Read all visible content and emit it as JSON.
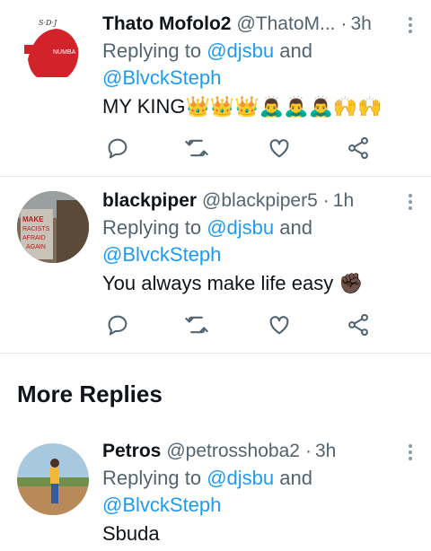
{
  "tweets": [
    {
      "name": "Thato Mofolo2",
      "handle": "@ThatoM...",
      "time": "3h",
      "replying_prefix": "Replying to ",
      "mention1": "@djsbu",
      "and": " and",
      "mention2": "@BlvckSteph",
      "text": "MY KING👑👑👑🙇‍♂️🙇‍♂️🙇‍♂️🙌🙌",
      "avatar_label": "NUMBA"
    },
    {
      "name": "blackpiper",
      "handle": "@blackpiper5",
      "time": "1h",
      "replying_prefix": "Replying to ",
      "mention1": "@djsbu",
      "and": " and",
      "mention2": "@BlvckSteph",
      "text": "You always make life easy ✊🏿",
      "avatar_label": "MAKE RACISTS AFRAID"
    },
    {
      "name": "Petros",
      "handle": "@petrosshoba2",
      "time": "3h",
      "replying_prefix": "Replying to ",
      "mention1": "@djsbu",
      "and": " and",
      "mention2": "@BlvckSteph",
      "text": "Sbuda"
    }
  ],
  "section": {
    "title": "More Replies"
  },
  "actions": [
    "reply-icon",
    "retweet-icon",
    "like-icon",
    "share-icon"
  ],
  "colors": {
    "accent": "#1d9bf0",
    "muted": "#536471",
    "icon": "#536471"
  }
}
